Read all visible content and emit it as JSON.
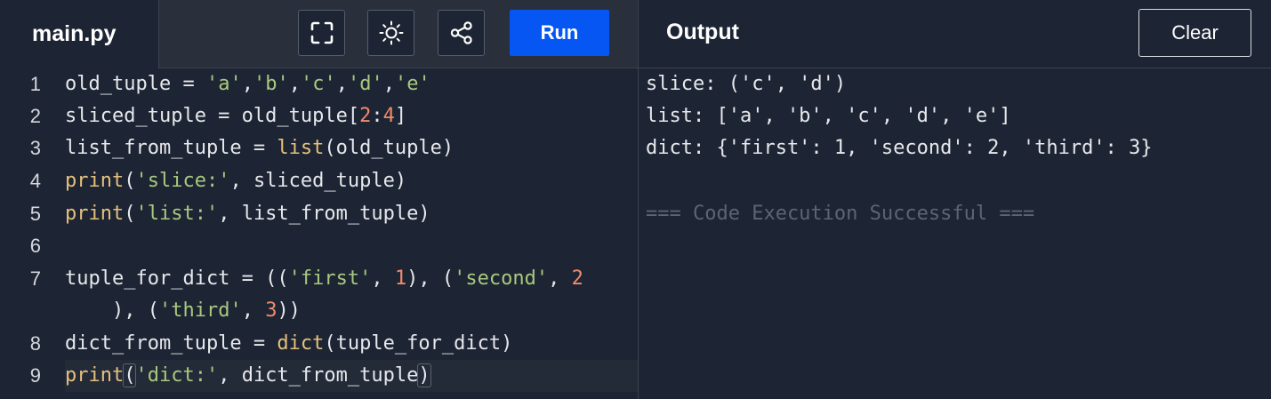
{
  "file_tab": {
    "label": "main.py"
  },
  "toolbar": {
    "fullscreen_icon": "fullscreen-icon",
    "theme_icon": "sun-icon",
    "share_icon": "share-icon",
    "run_label": "Run"
  },
  "output_panel": {
    "title": "Output",
    "clear_label": "Clear",
    "lines": [
      "slice: ('c', 'd')",
      "list: ['a', 'b', 'c', 'd', 'e']",
      "dict: {'first': 1, 'second': 2, 'third': 3}",
      "",
      "=== Code Execution Successful ==="
    ]
  },
  "editor": {
    "line_numbers": [
      "1",
      "2",
      "3",
      "4",
      "5",
      "6",
      "7",
      "8",
      "9"
    ],
    "lines": [
      [
        {
          "t": "old_tuple = ",
          "c": "op"
        },
        {
          "t": "'a'",
          "c": "str"
        },
        {
          "t": ",",
          "c": "op"
        },
        {
          "t": "'b'",
          "c": "str"
        },
        {
          "t": ",",
          "c": "op"
        },
        {
          "t": "'c'",
          "c": "str"
        },
        {
          "t": ",",
          "c": "op"
        },
        {
          "t": "'d'",
          "c": "str"
        },
        {
          "t": ",",
          "c": "op"
        },
        {
          "t": "'e'",
          "c": "str"
        }
      ],
      [
        {
          "t": "sliced_tuple = old_tuple[",
          "c": "op"
        },
        {
          "t": "2",
          "c": "num"
        },
        {
          "t": ":",
          "c": "op"
        },
        {
          "t": "4",
          "c": "num"
        },
        {
          "t": "]",
          "c": "op"
        }
      ],
      [
        {
          "t": "list_from_tuple = ",
          "c": "op"
        },
        {
          "t": "list",
          "c": "fn"
        },
        {
          "t": "(old_tuple)",
          "c": "op"
        }
      ],
      [
        {
          "t": "print",
          "c": "fn"
        },
        {
          "t": "(",
          "c": "op"
        },
        {
          "t": "'slice:'",
          "c": "str"
        },
        {
          "t": ", sliced_tuple)",
          "c": "op"
        }
      ],
      [
        {
          "t": "print",
          "c": "fn"
        },
        {
          "t": "(",
          "c": "op"
        },
        {
          "t": "'list:'",
          "c": "str"
        },
        {
          "t": ", list_from_tuple)",
          "c": "op"
        }
      ],
      [],
      [
        {
          "t": "tuple_for_dict = ((",
          "c": "op"
        },
        {
          "t": "'first'",
          "c": "str"
        },
        {
          "t": ", ",
          "c": "op"
        },
        {
          "t": "1",
          "c": "num"
        },
        {
          "t": "), (",
          "c": "op"
        },
        {
          "t": "'second'",
          "c": "str"
        },
        {
          "t": ", ",
          "c": "op"
        },
        {
          "t": "2",
          "c": "num"
        }
      ],
      [
        {
          "t": "    ), (",
          "c": "op"
        },
        {
          "t": "'third'",
          "c": "str"
        },
        {
          "t": ", ",
          "c": "op"
        },
        {
          "t": "3",
          "c": "num"
        },
        {
          "t": "))",
          "c": "op"
        }
      ],
      [
        {
          "t": "dict_from_tuple = ",
          "c": "op"
        },
        {
          "t": "dict",
          "c": "fn"
        },
        {
          "t": "(tuple_for_dict)",
          "c": "op"
        }
      ],
      [
        {
          "t": "print",
          "c": "fn"
        },
        {
          "t": "(",
          "c": "op",
          "hl": true
        },
        {
          "t": "'dict:'",
          "c": "str"
        },
        {
          "t": ", dict_from_tuple",
          "c": "op"
        },
        {
          "t": ")",
          "c": "op",
          "hl": true
        }
      ]
    ]
  },
  "colors": {
    "run_button": "#0556f3",
    "string": "#a8c97f",
    "number": "#f08b6a",
    "function": "#e5c07b",
    "muted_output": "#5d6472"
  }
}
